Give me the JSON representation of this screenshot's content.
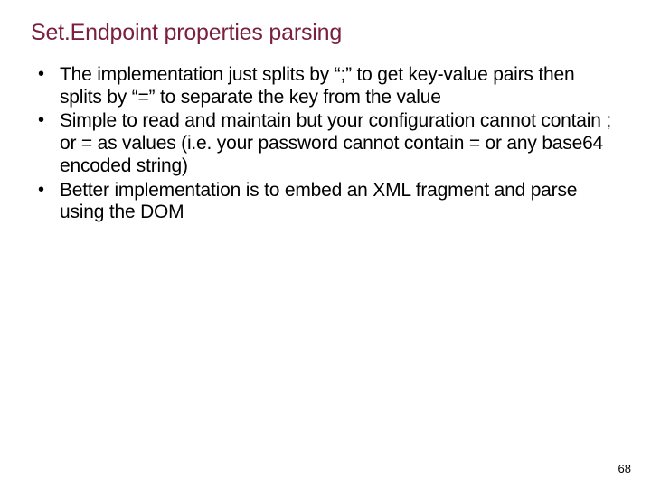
{
  "title": "Set.Endpoint properties parsing",
  "bullets": [
    "The implementation just splits by “;” to get key-value pairs then splits by “=” to separate the key from the value",
    "Simple to read and maintain but your configuration cannot contain ; or = as values (i.e. your password cannot contain = or any base64 encoded string)",
    "Better implementation is to embed an XML fragment and parse using the DOM"
  ],
  "page_number": "68"
}
